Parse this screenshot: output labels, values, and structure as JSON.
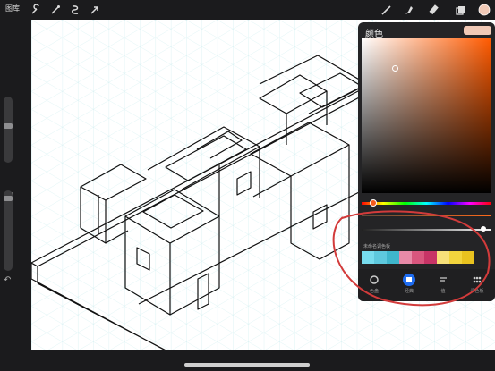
{
  "topbar": {
    "gallery_label": "图库",
    "left_tools": [
      "wrench-icon",
      "magic-wand-icon",
      "selection-icon",
      "transform-arrow-icon"
    ],
    "right_tools": [
      "brush-icon",
      "smudge-icon",
      "eraser-icon",
      "layers-icon",
      "color-icon"
    ],
    "current_color": "#f0c9b6"
  },
  "color_panel": {
    "title": "颜色",
    "current_color": "#f0c9b6",
    "hue_color": "#ff5a00",
    "palette_title": "未命名调色板",
    "palette": [
      "#77dcee",
      "#5ec9de",
      "#3fb6cc",
      "#e88aa8",
      "#d9567e",
      "#c73466",
      "#f7e07a",
      "#f2d43d",
      "#e9c21f"
    ],
    "tabs": [
      {
        "icon": "disc-icon",
        "label": "色盘",
        "selected": false
      },
      {
        "icon": "classic-icon",
        "label": "经典",
        "selected": true
      },
      {
        "icon": "harmony-icon",
        "label": "值",
        "selected": false
      },
      {
        "icon": "palettes-icon",
        "label": "调色板",
        "selected": false
      }
    ]
  },
  "annotation_color": "#d23b3b"
}
